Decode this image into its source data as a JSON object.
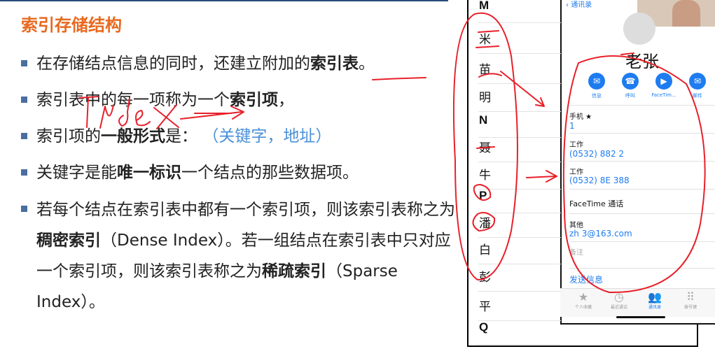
{
  "slide": {
    "title": "索引存储结构",
    "bullets": [
      {
        "parts": [
          {
            "t": "在存储结点信息的同时，还建立附加的"
          },
          {
            "t": "索引表",
            "b": true
          },
          {
            "t": "。"
          }
        ]
      },
      {
        "parts": [
          {
            "t": "索引表中的每一项称为一个"
          },
          {
            "t": "索引项",
            "b": true
          },
          {
            "t": "，"
          }
        ]
      },
      {
        "parts": [
          {
            "t": "索引项的"
          },
          {
            "t": "一般形式",
            "b": true
          },
          {
            "t": "是：  "
          },
          {
            "t": "（关键字，地址）",
            "blue": true
          }
        ]
      },
      {
        "parts": [
          {
            "t": "关键字是能"
          },
          {
            "t": "唯一标识",
            "b": true
          },
          {
            "t": "一个结点的那些数据项。"
          }
        ]
      },
      {
        "parts": [
          {
            "t": "若每个结点在索引表中都有一个索引项，则该索引表称之为"
          },
          {
            "t": "稠密索引",
            "b": true
          },
          {
            "t": "（Dense Index）。若一组结点在索引表中只对应一个索引项，则该索引表称之为"
          },
          {
            "t": "稀疏索引",
            "b": true
          },
          {
            "t": "（Sparse Index）。"
          }
        ]
      }
    ],
    "annotation": "Index"
  },
  "phone": {
    "index_entries": [
      "M",
      "米",
      "苗",
      "明",
      "N",
      "聂",
      "牛",
      "P",
      "潘",
      "白",
      "彭",
      "平",
      "Q"
    ],
    "back_label": "通讯录",
    "contact_name": "老张",
    "actions": [
      {
        "label": "信息",
        "icon": "message-icon"
      },
      {
        "label": "呼叫",
        "icon": "phone-icon"
      },
      {
        "label": "FaceTim...",
        "icon": "video-icon"
      },
      {
        "label": "邮件",
        "icon": "mail-icon"
      }
    ],
    "fields": [
      {
        "label": "手机 ★",
        "value": "1"
      },
      {
        "label": "工作",
        "value": "(0532) 882 2"
      },
      {
        "label": "工作",
        "value": "(0532) 8E 388"
      },
      {
        "label": "FaceTime 通话",
        "value": ""
      },
      {
        "label": "其他",
        "value": "zh 3@163.com"
      }
    ],
    "notes_label": "备注",
    "send_message": "发送信息",
    "tabs": [
      {
        "label": "个人收藏",
        "icon": "star-icon"
      },
      {
        "label": "最近通话",
        "icon": "clock-icon"
      },
      {
        "label": "通讯录",
        "icon": "contacts-icon",
        "active": true
      },
      {
        "label": "拨号键",
        "icon": "keypad-icon"
      }
    ]
  },
  "colors": {
    "title": "#e8691f",
    "accent_blue": "#1e7cf0",
    "ink": "#e8202a",
    "bullet": "#4a6ea0"
  }
}
